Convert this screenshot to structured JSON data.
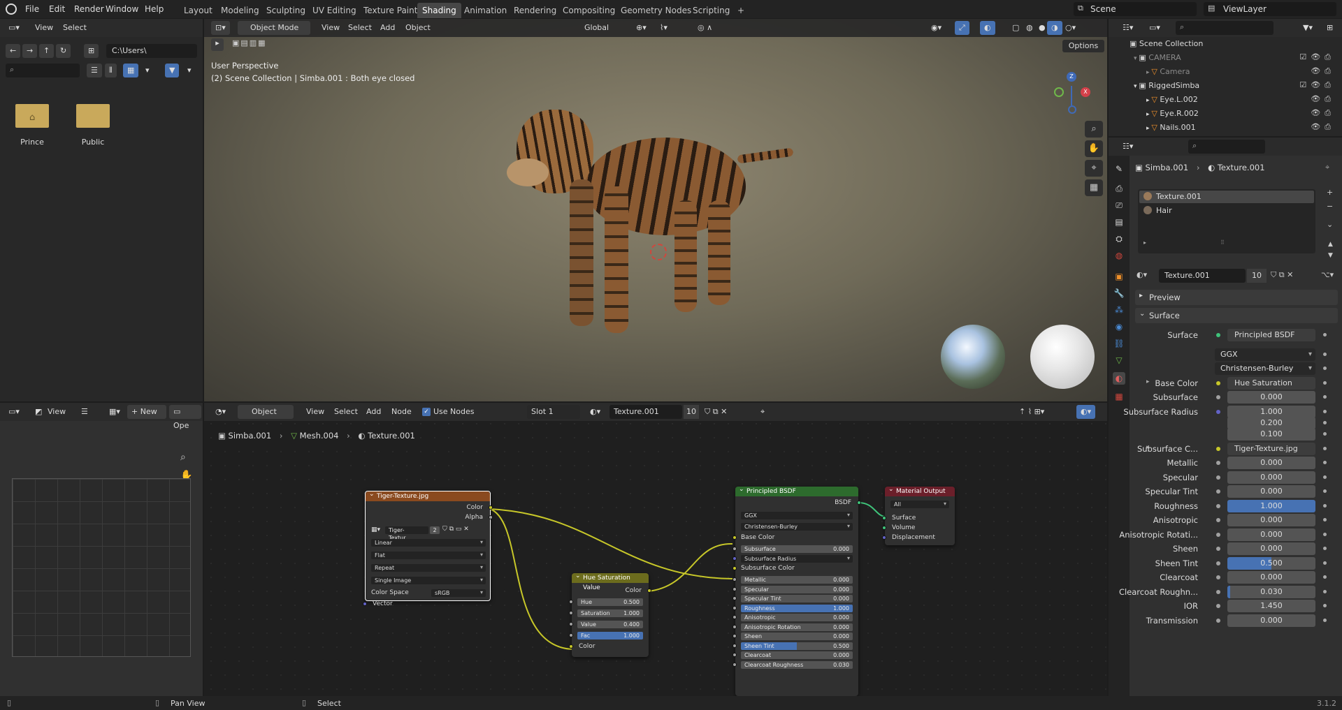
{
  "topbar": {
    "menus": [
      "File",
      "Edit",
      "Render",
      "Window",
      "Help"
    ],
    "workspaces": [
      "Layout",
      "Modeling",
      "Sculpting",
      "UV Editing",
      "Texture Paint",
      "Shading",
      "Animation",
      "Rendering",
      "Compositing",
      "Geometry Nodes",
      "Scripting"
    ],
    "active_workspace": "Shading",
    "add_tab": "+",
    "scene": "Scene",
    "view_layer": "ViewLayer"
  },
  "file_browser": {
    "menus": [
      "View",
      "Select"
    ],
    "path": "C:\\Users\\",
    "search_placeholder": "",
    "folders": [
      "Prince",
      "Public"
    ]
  },
  "viewport": {
    "mode": "Object Mode",
    "menus": [
      "View",
      "Select",
      "Add",
      "Object"
    ],
    "orientation": "Global",
    "options": "Options",
    "info_line1": "User Perspective",
    "info_line2": "(2) Scene Collection | Simba.001 : Both eye closed",
    "axes": {
      "x": "X",
      "y": "Y",
      "z": "Z"
    }
  },
  "image_editor": {
    "view": "View",
    "new": "New",
    "open": "Ope"
  },
  "node_editor": {
    "editor_type": "Object",
    "menus": [
      "View",
      "Select",
      "Add",
      "Node"
    ],
    "use_nodes": "Use Nodes",
    "slot": "Slot 1",
    "material": "Texture.001",
    "users": "10",
    "breadcrumb": [
      "Simba.001",
      "Mesh.004",
      "Texture.001"
    ],
    "nodes": {
      "image": {
        "title": "Tiger-Texture.jpg",
        "out_color": "Color",
        "out_alpha": "Alpha",
        "image_name": "Tiger-Textur...",
        "image_users": "2",
        "interp": "Linear",
        "proj": "Flat",
        "ext": "Repeat",
        "source": "Single Image",
        "cs_label": "Color Space",
        "cs_value": "sRGB",
        "vector": "Vector"
      },
      "hsv": {
        "title": "Hue Saturation Value",
        "out_color": "Color",
        "fields": [
          {
            "label": "Hue",
            "value": "0.500"
          },
          {
            "label": "Saturation",
            "value": "1.000"
          },
          {
            "label": "Value",
            "value": "0.400"
          },
          {
            "label": "Fac",
            "value": "1.000"
          }
        ],
        "in_color": "Color"
      },
      "bsdf": {
        "title": "Principled BSDF",
        "out": "BSDF",
        "dist": "GGX",
        "sss": "Christensen-Burley",
        "base_color": "Base Color",
        "subsurface": {
          "label": "Subsurface",
          "value": "0.000"
        },
        "subsurface_radius": "Subsurface Radius",
        "subsurface_color": "Subsurface Color",
        "fields": [
          {
            "label": "Metallic",
            "value": "0.000"
          },
          {
            "label": "Specular",
            "value": "0.000"
          },
          {
            "label": "Specular Tint",
            "value": "0.000"
          },
          {
            "label": "Roughness",
            "value": "1.000"
          },
          {
            "label": "Anisotropic",
            "value": "0.000"
          },
          {
            "label": "Anisotropic Rotation",
            "value": "0.000"
          },
          {
            "label": "Sheen",
            "value": "0.000"
          },
          {
            "label": "Sheen Tint",
            "value": "0.500"
          },
          {
            "label": "Clearcoat",
            "value": "0.000"
          },
          {
            "label": "Clearcoat Roughness",
            "value": "0.030"
          }
        ]
      },
      "output": {
        "title": "Material Output",
        "target": "All",
        "sockets": [
          "Surface",
          "Volume",
          "Displacement"
        ]
      }
    }
  },
  "outliner": {
    "root": "Scene Collection",
    "rows": [
      {
        "name": "CAMERA",
        "indent": 1,
        "dim": true
      },
      {
        "name": "Camera",
        "indent": 2,
        "dim": true
      },
      {
        "name": "RiggedSimba",
        "indent": 1,
        "dim": false
      },
      {
        "name": "Eye.L.002",
        "indent": 2,
        "dim": false
      },
      {
        "name": "Eye.R.002",
        "indent": 2,
        "dim": false
      },
      {
        "name": "Nails.001",
        "indent": 2,
        "dim": false
      }
    ]
  },
  "properties": {
    "breadcrumb_object": "Simba.001",
    "breadcrumb_material": "Texture.001",
    "slots": [
      "Texture.001",
      "Hair"
    ],
    "material_name": "Texture.001",
    "material_users": "10",
    "preview": "Preview",
    "surface_panel": "Surface",
    "surface_label": "Surface",
    "surface_value": "Principled BSDF",
    "distribution": "GGX",
    "sss_method": "Christensen-Burley",
    "base_color_label": "Base Color",
    "base_color_value": "Hue Saturation Value",
    "subsurface_label": "Subsurface",
    "subsurface_value": "0.000",
    "ss_radius_label": "Subsurface Radius",
    "ss_radius_values": [
      "1.000",
      "0.200",
      "0.100"
    ],
    "ss_color_label": "Subsurface C...",
    "ss_color_value": "Tiger-Texture.jpg",
    "fields": [
      {
        "label": "Metallic",
        "value": "0.000",
        "fill": 0
      },
      {
        "label": "Specular",
        "value": "0.000",
        "fill": 0
      },
      {
        "label": "Specular Tint",
        "value": "0.000",
        "fill": 0
      },
      {
        "label": "Roughness",
        "value": "1.000",
        "fill": 1
      },
      {
        "label": "Anisotropic",
        "value": "0.000",
        "fill": 0
      },
      {
        "label": "Anisotropic Rotati...",
        "value": "0.000",
        "fill": 0
      },
      {
        "label": "Sheen",
        "value": "0.000",
        "fill": 0
      },
      {
        "label": "Sheen Tint",
        "value": "0.500",
        "fill": 0.5
      },
      {
        "label": "Clearcoat",
        "value": "0.000",
        "fill": 0
      },
      {
        "label": "Clearcoat Roughn...",
        "value": "0.030",
        "fill": 0.03
      },
      {
        "label": "IOR",
        "value": "1.450",
        "fill": 0
      },
      {
        "label": "Transmission",
        "value": "0.000",
        "fill": 0
      }
    ]
  },
  "statusbar": {
    "pan": "Pan View",
    "select": "Select",
    "version": "3.1.2"
  },
  "colors": {
    "accent": "#4772b3",
    "image_node": "#8a4a1f",
    "hsv_node": "#6c6c1d",
    "bsdf_node": "#2d6b2d",
    "output_node": "#6b1f2a",
    "yellow_link": "#c7c729",
    "green_link": "#3fc37a"
  }
}
